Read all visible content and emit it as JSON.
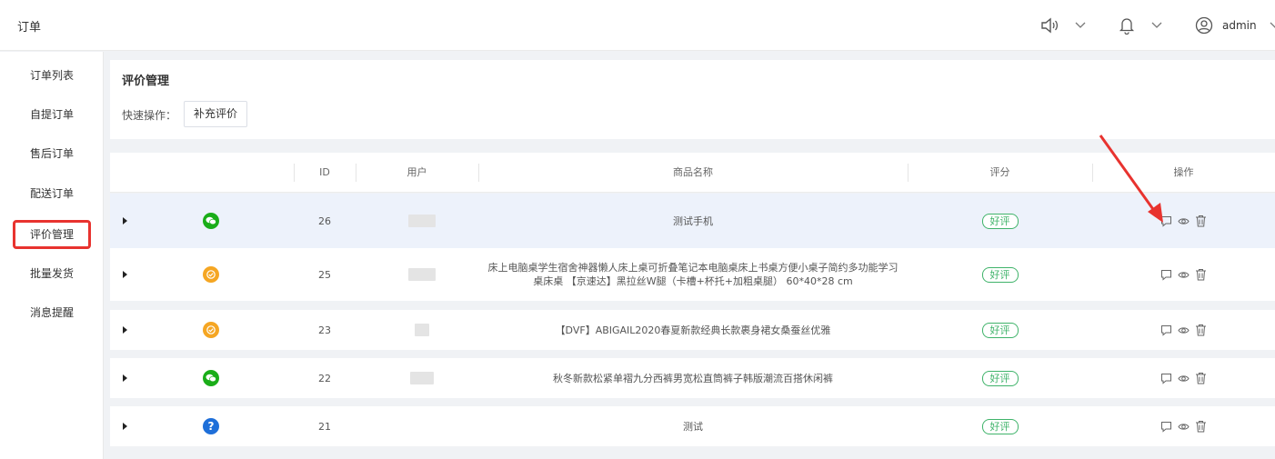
{
  "app": {
    "title": "订单"
  },
  "topbar": {
    "admin": "admin"
  },
  "sidebar": {
    "items": [
      {
        "label": "订单列表"
      },
      {
        "label": "自提订单"
      },
      {
        "label": "售后订单"
      },
      {
        "label": "配送订单"
      },
      {
        "label": "评价管理"
      },
      {
        "label": "批量发货"
      },
      {
        "label": "消息提醒"
      }
    ]
  },
  "panel": {
    "title": "评价管理",
    "quick_label": "快速操作：",
    "quick_button": "补充评价"
  },
  "table": {
    "headers": {
      "id": "ID",
      "user": "用户",
      "goods": "商品名称",
      "score": "评分",
      "ops": "操作"
    },
    "rows": [
      {
        "id": "26",
        "source": "wechat-icon",
        "goods": "测试手机",
        "score": "好评"
      },
      {
        "id": "25",
        "source": "miniapp-icon",
        "goods": "床上电脑桌学生宿舍神器懒人床上桌可折叠笔记本电脑桌床上书桌方便小桌子简约多功能学习桌床桌 【京速达】黑拉丝W腿（卡槽+杯托+加粗桌腿） 60*40*28 cm",
        "score": "好评"
      },
      {
        "id": "23",
        "source": "miniapp-icon",
        "goods": "【DVF】ABIGAIL2020春夏新款经典长款裹身裙女桑蚕丝优雅",
        "score": "好评"
      },
      {
        "id": "22",
        "source": "wechat-icon",
        "goods": "秋冬新款松紧单褶九分西裤男宽松直筒裤子韩版潮流百搭休闲裤",
        "score": "好评"
      },
      {
        "id": "21",
        "source": "unknown-icon",
        "goods": "测试",
        "score": "好评"
      }
    ]
  },
  "colors": {
    "accent_red": "#e8332f",
    "wechat": "#1aad19",
    "miniapp": "#f5a623",
    "unknown": "#1e6fd9",
    "tag_green": "#3fb36a"
  }
}
